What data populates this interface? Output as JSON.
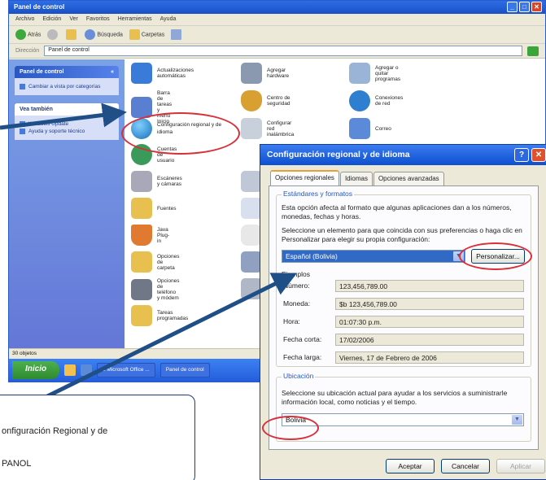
{
  "cp": {
    "title": "Panel de control",
    "menu": [
      "Archivo",
      "Edición",
      "Ver",
      "Favoritos",
      "Herramientas",
      "Ayuda"
    ],
    "toolbar": {
      "back": "Atrás",
      "search": "Búsqueda",
      "folders": "Carpetas"
    },
    "address": {
      "label": "Dirección",
      "value": "Panel de control"
    },
    "left_pane": {
      "panel_title": "Panel de control",
      "switch_view": "Cambiar a vista por categorías",
      "see_also": "Vea también",
      "links": [
        "Windows Update",
        "Ayuda y soporte técnico"
      ]
    },
    "items": [
      "Actualizaciones automáticas",
      "Agregar hardware",
      "Agregar o quitar programas",
      "Barra de tareas y menú Inicio",
      "Centro de seguridad",
      "Conexiones de red",
      "Configuración regional y de idioma",
      "Configurar red inalámbrica",
      "Correo",
      "Cuentas de usuario",
      "Escáneres y cámaras",
      "Fuentes",
      "Java Plug-in",
      "Opciones de carpeta",
      "Opciones de teléfono y módem",
      "Tareas programadas"
    ],
    "status": "30 objetos",
    "taskbar": {
      "start": "Inicio",
      "tasks": [
        "2 Microsoft Office ...",
        "Panel de control"
      ]
    }
  },
  "dialog": {
    "title": "Configuración regional y de idioma",
    "help_glyph": "?",
    "close_glyph": "✕",
    "tabs": [
      "Opciones regionales",
      "Idiomas",
      "Opciones avanzadas"
    ],
    "standards": {
      "legend": "Estándares y formatos",
      "desc": "Esta opción afecta al formato que algunas aplicaciones dan a los números, monedas, fechas y horas.",
      "instr": "Seleccione un elemento para que coincida con sus preferencias o haga clic en Personalizar para elegir su propia configuración:",
      "selected_locale": "Español (Bolivia)",
      "customize_btn": "Personalizar...",
      "examples_label": "Ejemplos",
      "examples": [
        {
          "label": "Número:",
          "value": "123,456,789.00"
        },
        {
          "label": "Moneda:",
          "value": "$b 123,456,789.00"
        },
        {
          "label": "Hora:",
          "value": "01:07:30 p.m."
        },
        {
          "label": "Fecha corta:",
          "value": "17/02/2006"
        },
        {
          "label": "Fecha larga:",
          "value": "Viernes, 17 de Febrero de 2006"
        }
      ]
    },
    "location": {
      "legend": "Ubicación",
      "desc": "Seleccione su ubicación actual para ayudar a los servicios a suministrarle información local, como noticias y el tiempo.",
      "value": "Bolivia"
    },
    "buttons": {
      "ok": "Aceptar",
      "cancel": "Cancelar",
      "apply": "Aplicar"
    }
  },
  "callout": {
    "line1": "onfiguración Regional y de",
    "line2": "PANOL"
  },
  "colors": {
    "arrow": "#1f4f86",
    "highlight": "#d8303a",
    "xp_blue": "#0d4fcf"
  }
}
